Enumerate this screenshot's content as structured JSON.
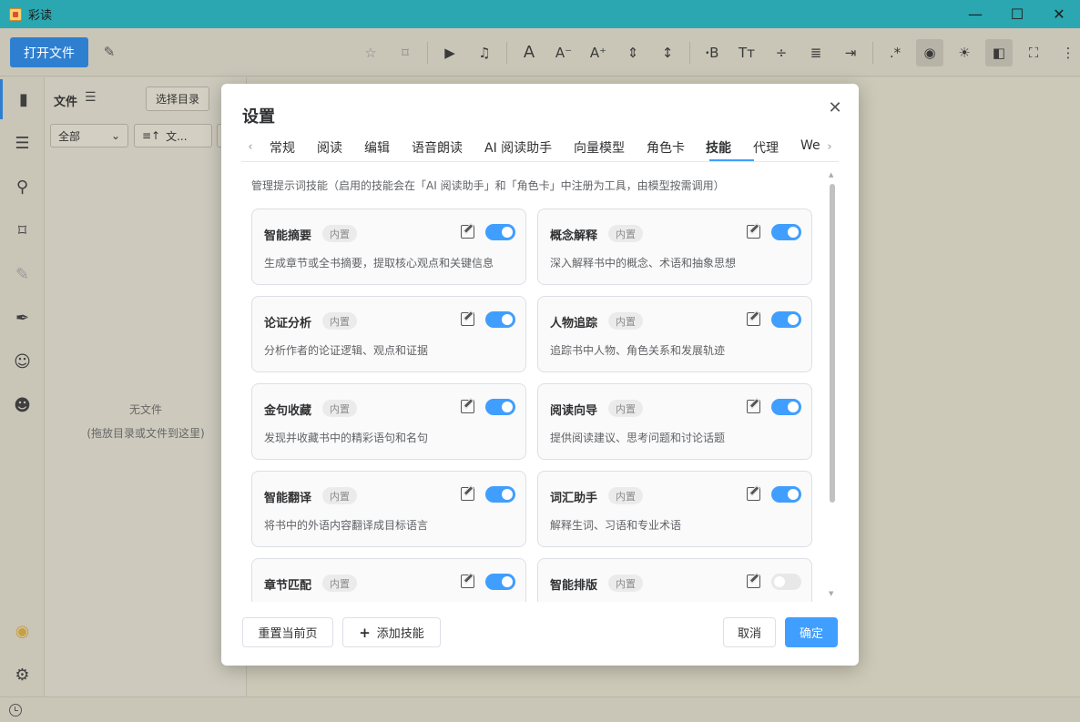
{
  "window": {
    "title": "彩读",
    "controls": [
      "—",
      "☐",
      "✕"
    ]
  },
  "toolbar": {
    "open_file": "打开文件",
    "icons": [
      "pin-icon",
      "bookmark-icon",
      "play-icon",
      "headphones-icon",
      "font-size-icon",
      "font-decrease-icon",
      "font-increase-icon",
      "letter-spacing-icon",
      "line-height-icon",
      "font-family-icon",
      "text-style-icon",
      "paragraph-spacing-icon",
      "align-icon",
      "page-mode-icon",
      "regex-icon",
      "palette-icon",
      "brightness-icon",
      "sidebar-toggle-icon",
      "fullscreen-icon",
      "more-icon"
    ]
  },
  "rail": {
    "items": [
      "book-icon",
      "toc-icon",
      "search-icon",
      "bookmark-icon",
      "highlighter-icon",
      "pen-icon",
      "ai-chat-icon",
      "emoji-icon",
      "palette-icon",
      "settings-icon"
    ]
  },
  "file_panel": {
    "title": "文件",
    "select_dir": "选择目录",
    "filter_all": "全部",
    "filter_sort": "文...",
    "empty_title": "无文件",
    "empty_hint": "(拖放目录或文件到这里)"
  },
  "dialog": {
    "title": "设置",
    "tabs": [
      "常规",
      "阅读",
      "编辑",
      "语音朗读",
      "AI 阅读助手",
      "向量模型",
      "角色卡",
      "技能",
      "代理",
      "We"
    ],
    "active_tab": "技能",
    "description": "管理提示词技能（启用的技能会在「AI 阅读助手」和「角色卡」中注册为工具，由模型按需调用）",
    "builtin_label": "内置",
    "skills": [
      {
        "name": "智能摘要",
        "desc": "生成章节或全书摘要，提取核心观点和关键信息",
        "enabled": true
      },
      {
        "name": "概念解释",
        "desc": "深入解释书中的概念、术语和抽象思想",
        "enabled": true
      },
      {
        "name": "论证分析",
        "desc": "分析作者的论证逻辑、观点和证据",
        "enabled": true
      },
      {
        "name": "人物追踪",
        "desc": "追踪书中人物、角色关系和发展轨迹",
        "enabled": true
      },
      {
        "name": "金句收藏",
        "desc": "发现并收藏书中的精彩语句和名句",
        "enabled": true
      },
      {
        "name": "阅读向导",
        "desc": "提供阅读建议、思考问题和讨论话题",
        "enabled": true
      },
      {
        "name": "智能翻译",
        "desc": "将书中的外语内容翻译成目标语言",
        "enabled": true
      },
      {
        "name": "词汇助手",
        "desc": "解释生词、习语和专业术语",
        "enabled": true
      },
      {
        "name": "章节匹配",
        "desc": "",
        "enabled": true
      },
      {
        "name": "智能排版",
        "desc": "",
        "enabled": false
      }
    ],
    "reset_button": "重置当前页",
    "add_button": "添加技能",
    "cancel_button": "取消",
    "ok_button": "确定"
  }
}
